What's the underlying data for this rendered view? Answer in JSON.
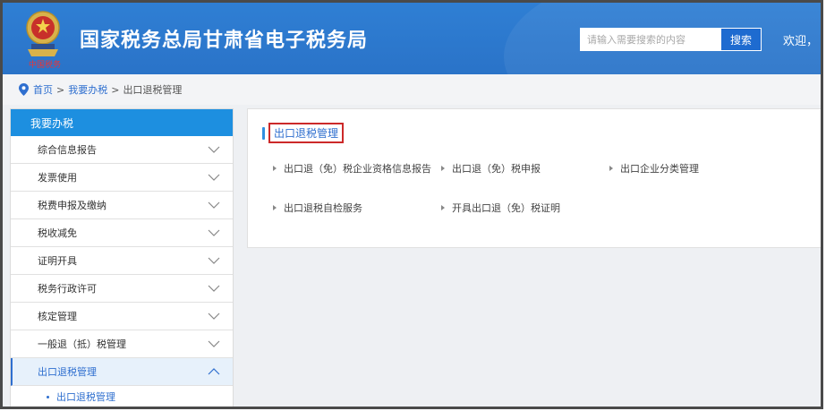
{
  "header": {
    "site_title": "国家税务总局甘肃省电子税务局",
    "emblem_caption": "中国税务",
    "search_placeholder": "请输入需要搜索的内容",
    "search_button": "搜索",
    "welcome": "欢迎，"
  },
  "breadcrumb": {
    "home": "首页",
    "sep1": ">",
    "level1": "我要办税",
    "sep2": ">",
    "current": "出口退税管理"
  },
  "sidebar": {
    "title": "我要办税",
    "items": [
      {
        "label": "综合信息报告"
      },
      {
        "label": "发票使用"
      },
      {
        "label": "税费申报及缴纳"
      },
      {
        "label": "税收减免"
      },
      {
        "label": "证明开具"
      },
      {
        "label": "税务行政许可"
      },
      {
        "label": "核定管理"
      },
      {
        "label": "一般退（抵）税管理"
      },
      {
        "label": "出口退税管理"
      }
    ],
    "sub_items": [
      {
        "label": "出口退税管理"
      }
    ]
  },
  "panel": {
    "title": "出口退税管理",
    "links": [
      {
        "label": "出口退（免）税企业资格信息报告"
      },
      {
        "label": "出口退（免）税申报"
      },
      {
        "label": "出口企业分类管理"
      },
      {
        "label": "出口退税自检服务"
      },
      {
        "label": "开具出口退（免）税证明"
      }
    ]
  },
  "colors": {
    "header_blue": "#2a73c8",
    "sidebar_header": "#1d8fe0",
    "link_blue": "#2f6fcf",
    "highlight_red": "#cc2929"
  }
}
